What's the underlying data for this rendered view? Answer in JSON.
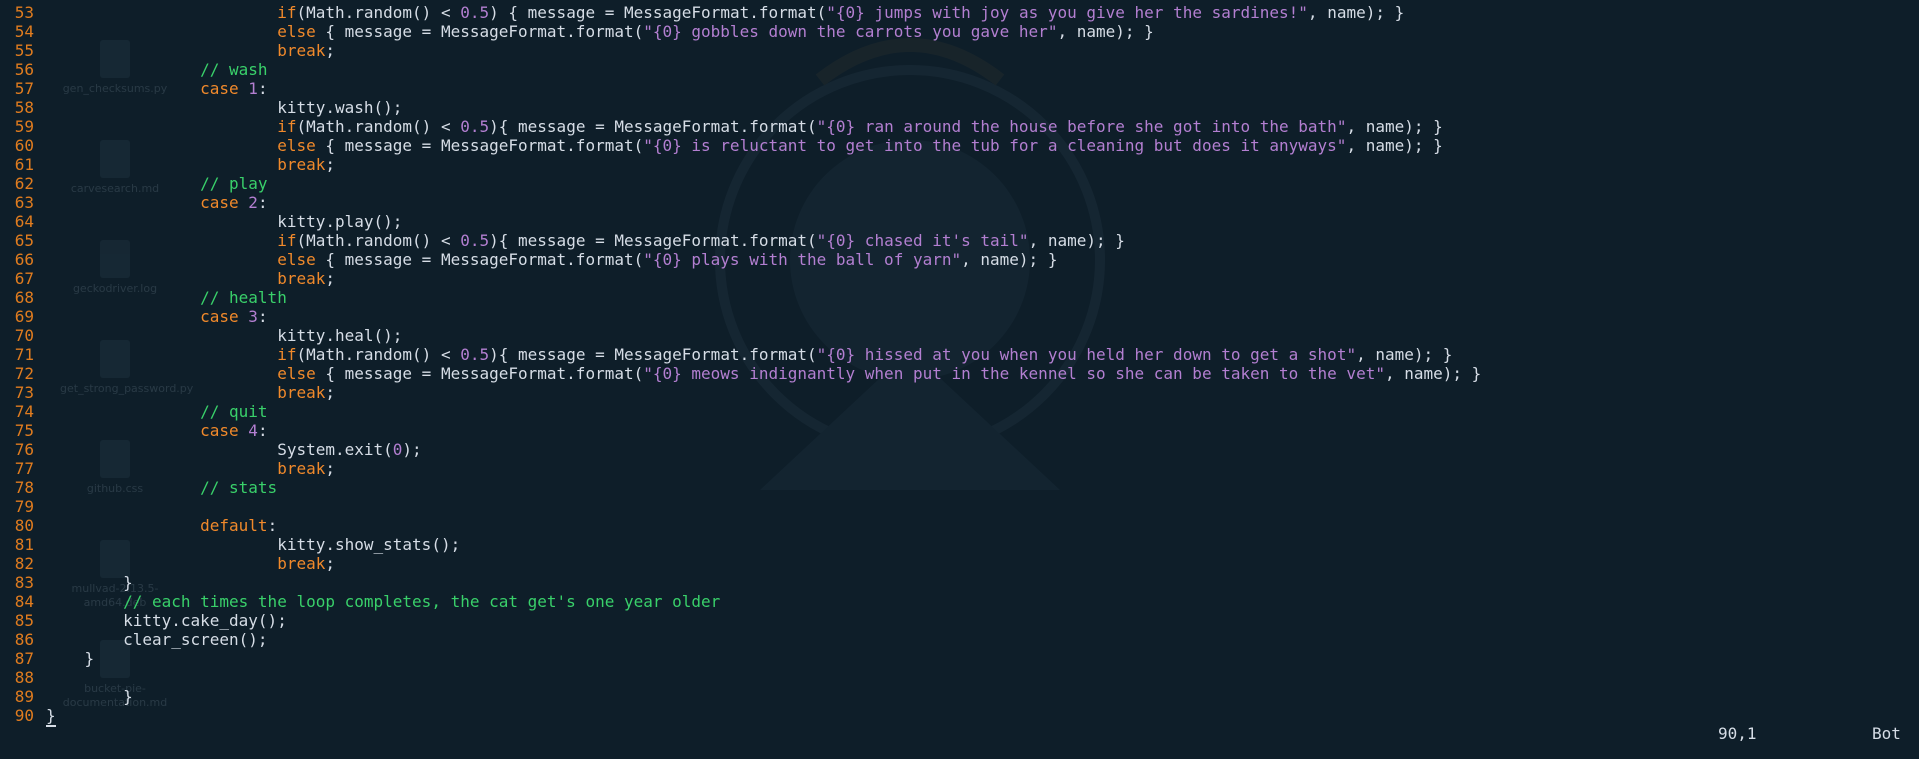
{
  "desktop_icons": [
    {
      "label": "gen_checksums.py",
      "glyph": "py"
    },
    {
      "label": "carvesearch.md",
      "glyph": "doc"
    },
    {
      "label": "geckodriver.log",
      "glyph": "doc"
    },
    {
      "label": "get_strong_password.py",
      "glyph": "py"
    },
    {
      "label": "github.css",
      "glyph": "3"
    },
    {
      "label": "mullvad-2.13.5-amd64.deb",
      "glyph": "deb"
    },
    {
      "label": "bucket-pie-documentation.md",
      "glyph": "doc"
    }
  ],
  "code_lines": [
    {
      "n": "53",
      "t": [
        [
          "",
          "                        "
        ],
        [
          "kw",
          "if"
        ],
        [
          "",
          "(Math.random() < "
        ],
        [
          "num",
          "0.5"
        ],
        [
          "",
          ") { message = MessageFormat.format("
        ],
        [
          "str",
          "\"{0} jumps with joy as you give her the sardines!\""
        ],
        [
          "",
          ", name); }"
        ]
      ]
    },
    {
      "n": "54",
      "t": [
        [
          "",
          "                        "
        ],
        [
          "kw",
          "else"
        ],
        [
          "",
          " { message = MessageFormat.format("
        ],
        [
          "str",
          "\"{0} gobbles down the carrots you gave her\""
        ],
        [
          "",
          ", name); }"
        ]
      ]
    },
    {
      "n": "55",
      "t": [
        [
          "",
          "                        "
        ],
        [
          "kw",
          "break"
        ],
        [
          "",
          ";"
        ]
      ]
    },
    {
      "n": "56",
      "t": [
        [
          "",
          "                "
        ],
        [
          "cm",
          "// wash"
        ]
      ]
    },
    {
      "n": "57",
      "t": [
        [
          "",
          "                "
        ],
        [
          "kw",
          "case"
        ],
        [
          "",
          " "
        ],
        [
          "num",
          "1"
        ],
        [
          "",
          ":"
        ]
      ]
    },
    {
      "n": "58",
      "t": [
        [
          "",
          "                        kitty.wash();"
        ]
      ]
    },
    {
      "n": "59",
      "t": [
        [
          "",
          "                        "
        ],
        [
          "kw",
          "if"
        ],
        [
          "",
          "(Math.random() < "
        ],
        [
          "num",
          "0.5"
        ],
        [
          "",
          "){ message = MessageFormat.format("
        ],
        [
          "str",
          "\"{0} ran around the house before she got into the bath\""
        ],
        [
          "",
          ", name); }"
        ]
      ]
    },
    {
      "n": "60",
      "t": [
        [
          "",
          "                        "
        ],
        [
          "kw",
          "else"
        ],
        [
          "",
          " { message = MessageFormat.format("
        ],
        [
          "str",
          "\"{0} is reluctant to get into the tub for a cleaning but does it anyways\""
        ],
        [
          "",
          ", name); }"
        ]
      ]
    },
    {
      "n": "61",
      "t": [
        [
          "",
          "                        "
        ],
        [
          "kw",
          "break"
        ],
        [
          "",
          ";"
        ]
      ]
    },
    {
      "n": "62",
      "t": [
        [
          "",
          "                "
        ],
        [
          "cm",
          "// play"
        ]
      ]
    },
    {
      "n": "63",
      "t": [
        [
          "",
          "                "
        ],
        [
          "kw",
          "case"
        ],
        [
          "",
          " "
        ],
        [
          "num",
          "2"
        ],
        [
          "",
          ":"
        ]
      ]
    },
    {
      "n": "64",
      "t": [
        [
          "",
          "                        kitty.play();"
        ]
      ]
    },
    {
      "n": "65",
      "t": [
        [
          "",
          "                        "
        ],
        [
          "kw",
          "if"
        ],
        [
          "",
          "(Math.random() < "
        ],
        [
          "num",
          "0.5"
        ],
        [
          "",
          "){ message = MessageFormat.format("
        ],
        [
          "str",
          "\"{0} chased it's tail\""
        ],
        [
          "",
          ", name); }"
        ]
      ]
    },
    {
      "n": "66",
      "t": [
        [
          "",
          "                        "
        ],
        [
          "kw",
          "else"
        ],
        [
          "",
          " { message = MessageFormat.format("
        ],
        [
          "str",
          "\"{0} plays with the ball of yarn\""
        ],
        [
          "",
          ", name); }"
        ]
      ]
    },
    {
      "n": "67",
      "t": [
        [
          "",
          "                        "
        ],
        [
          "kw",
          "break"
        ],
        [
          "",
          ";"
        ]
      ]
    },
    {
      "n": "68",
      "t": [
        [
          "",
          "                "
        ],
        [
          "cm",
          "// health"
        ]
      ]
    },
    {
      "n": "69",
      "t": [
        [
          "",
          "                "
        ],
        [
          "kw",
          "case"
        ],
        [
          "",
          " "
        ],
        [
          "num",
          "3"
        ],
        [
          "",
          ":"
        ]
      ]
    },
    {
      "n": "70",
      "t": [
        [
          "",
          "                        kitty.heal();"
        ]
      ]
    },
    {
      "n": "71",
      "t": [
        [
          "",
          "                        "
        ],
        [
          "kw",
          "if"
        ],
        [
          "",
          "(Math.random() < "
        ],
        [
          "num",
          "0.5"
        ],
        [
          "",
          "){ message = MessageFormat.format("
        ],
        [
          "str",
          "\"{0} hissed at you when you held her down to get a shot\""
        ],
        [
          "",
          ", name); }"
        ]
      ]
    },
    {
      "n": "72",
      "t": [
        [
          "",
          "                        "
        ],
        [
          "kw",
          "else"
        ],
        [
          "",
          " { message = MessageFormat.format("
        ],
        [
          "str",
          "\"{0} meows indignantly when put in the kennel so she can be taken to the vet\""
        ],
        [
          "",
          ", name); }"
        ]
      ]
    },
    {
      "n": "73",
      "t": [
        [
          "",
          "                        "
        ],
        [
          "kw",
          "break"
        ],
        [
          "",
          ";"
        ]
      ]
    },
    {
      "n": "74",
      "t": [
        [
          "",
          "                "
        ],
        [
          "cm",
          "// quit"
        ]
      ]
    },
    {
      "n": "75",
      "t": [
        [
          "",
          "                "
        ],
        [
          "kw",
          "case"
        ],
        [
          "",
          " "
        ],
        [
          "num",
          "4"
        ],
        [
          "",
          ":"
        ]
      ]
    },
    {
      "n": "76",
      "t": [
        [
          "",
          "                        System.exit("
        ],
        [
          "num",
          "0"
        ],
        [
          "",
          ");"
        ]
      ]
    },
    {
      "n": "77",
      "t": [
        [
          "",
          "                        "
        ],
        [
          "kw",
          "break"
        ],
        [
          "",
          ";"
        ]
      ]
    },
    {
      "n": "78",
      "t": [
        [
          "",
          "                "
        ],
        [
          "cm",
          "// stats"
        ]
      ]
    },
    {
      "n": "79",
      "t": [
        [
          "",
          ""
        ]
      ]
    },
    {
      "n": "80",
      "t": [
        [
          "",
          "                "
        ],
        [
          "kw",
          "default"
        ],
        [
          "",
          ":"
        ]
      ]
    },
    {
      "n": "81",
      "t": [
        [
          "",
          "                        kitty.show_stats();"
        ]
      ]
    },
    {
      "n": "82",
      "t": [
        [
          "",
          "                        "
        ],
        [
          "kw",
          "break"
        ],
        [
          "",
          ";"
        ]
      ]
    },
    {
      "n": "83",
      "t": [
        [
          "",
          "        }"
        ]
      ]
    },
    {
      "n": "84",
      "t": [
        [
          "",
          "        "
        ],
        [
          "cm",
          "// each times the loop completes, the cat get's one year older"
        ]
      ]
    },
    {
      "n": "85",
      "t": [
        [
          "",
          "        kitty.cake_day();"
        ]
      ]
    },
    {
      "n": "86",
      "t": [
        [
          "",
          "        clear_screen();"
        ]
      ]
    },
    {
      "n": "87",
      "t": [
        [
          "",
          "    }"
        ]
      ]
    },
    {
      "n": "88",
      "t": [
        [
          "",
          ""
        ]
      ]
    },
    {
      "n": "89",
      "t": [
        [
          "",
          "        }"
        ]
      ]
    },
    {
      "n": "90",
      "t": [
        [
          "cursor",
          "}"
        ]
      ]
    }
  ],
  "status": {
    "position": "90,1",
    "scroll": "Bot"
  }
}
